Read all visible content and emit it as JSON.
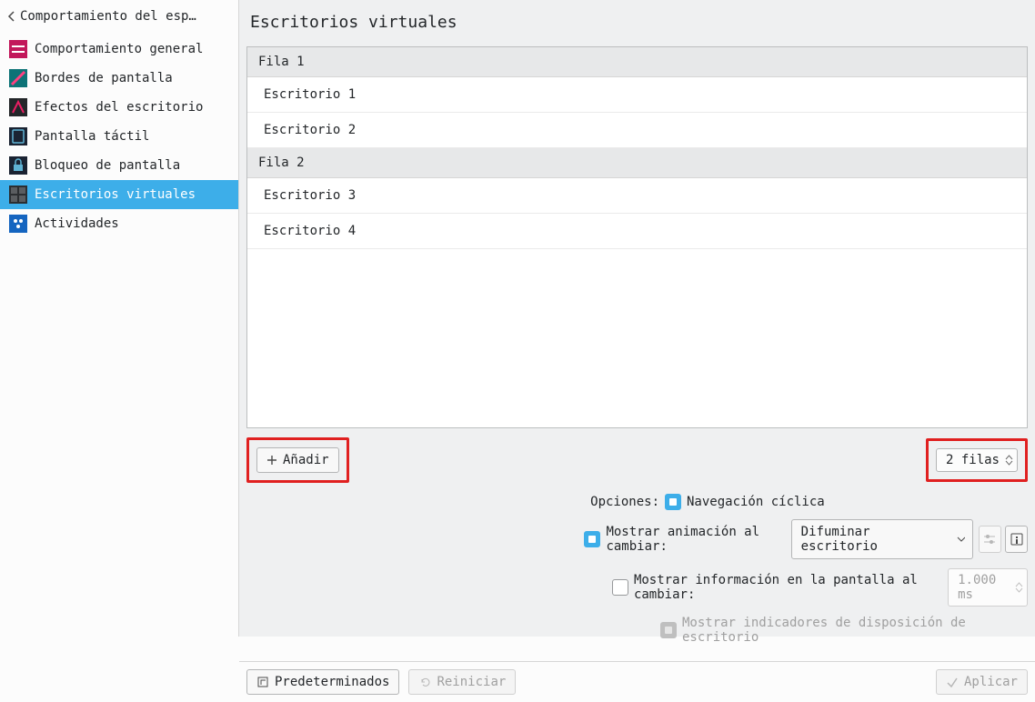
{
  "sidebar": {
    "title": "Comportamiento del esp…",
    "items": [
      {
        "label": "Comportamiento general",
        "icon": "general"
      },
      {
        "label": "Bordes de pantalla",
        "icon": "edges"
      },
      {
        "label": "Efectos del escritorio",
        "icon": "effects"
      },
      {
        "label": "Pantalla táctil",
        "icon": "touch"
      },
      {
        "label": "Bloqueo de pantalla",
        "icon": "lock"
      },
      {
        "label": "Escritorios virtuales",
        "icon": "vd",
        "active": true
      },
      {
        "label": "Actividades",
        "icon": "activities"
      }
    ]
  },
  "main": {
    "title": "Escritorios virtuales",
    "rows": [
      {
        "header": "Fila 1",
        "desktops": [
          "Escritorio 1",
          "Escritorio 2"
        ]
      },
      {
        "header": "Fila 2",
        "desktops": [
          "Escritorio 3",
          "Escritorio 4"
        ]
      }
    ],
    "add_label": "Añadir",
    "rows_spin": "2 filas",
    "options_label": "Opciones:",
    "opt_wrap": "Navegación cíclica",
    "opt_anim": "Mostrar animación al cambiar:",
    "anim_combo": "Difuminar escritorio",
    "opt_osd": "Mostrar información en la pantalla al cambiar:",
    "osd_time": "1.000 ms",
    "opt_layout": "Mostrar indicadores de disposición de escritorio"
  },
  "footer": {
    "defaults": "Predeterminados",
    "reset": "Reiniciar",
    "apply": "Aplicar"
  }
}
